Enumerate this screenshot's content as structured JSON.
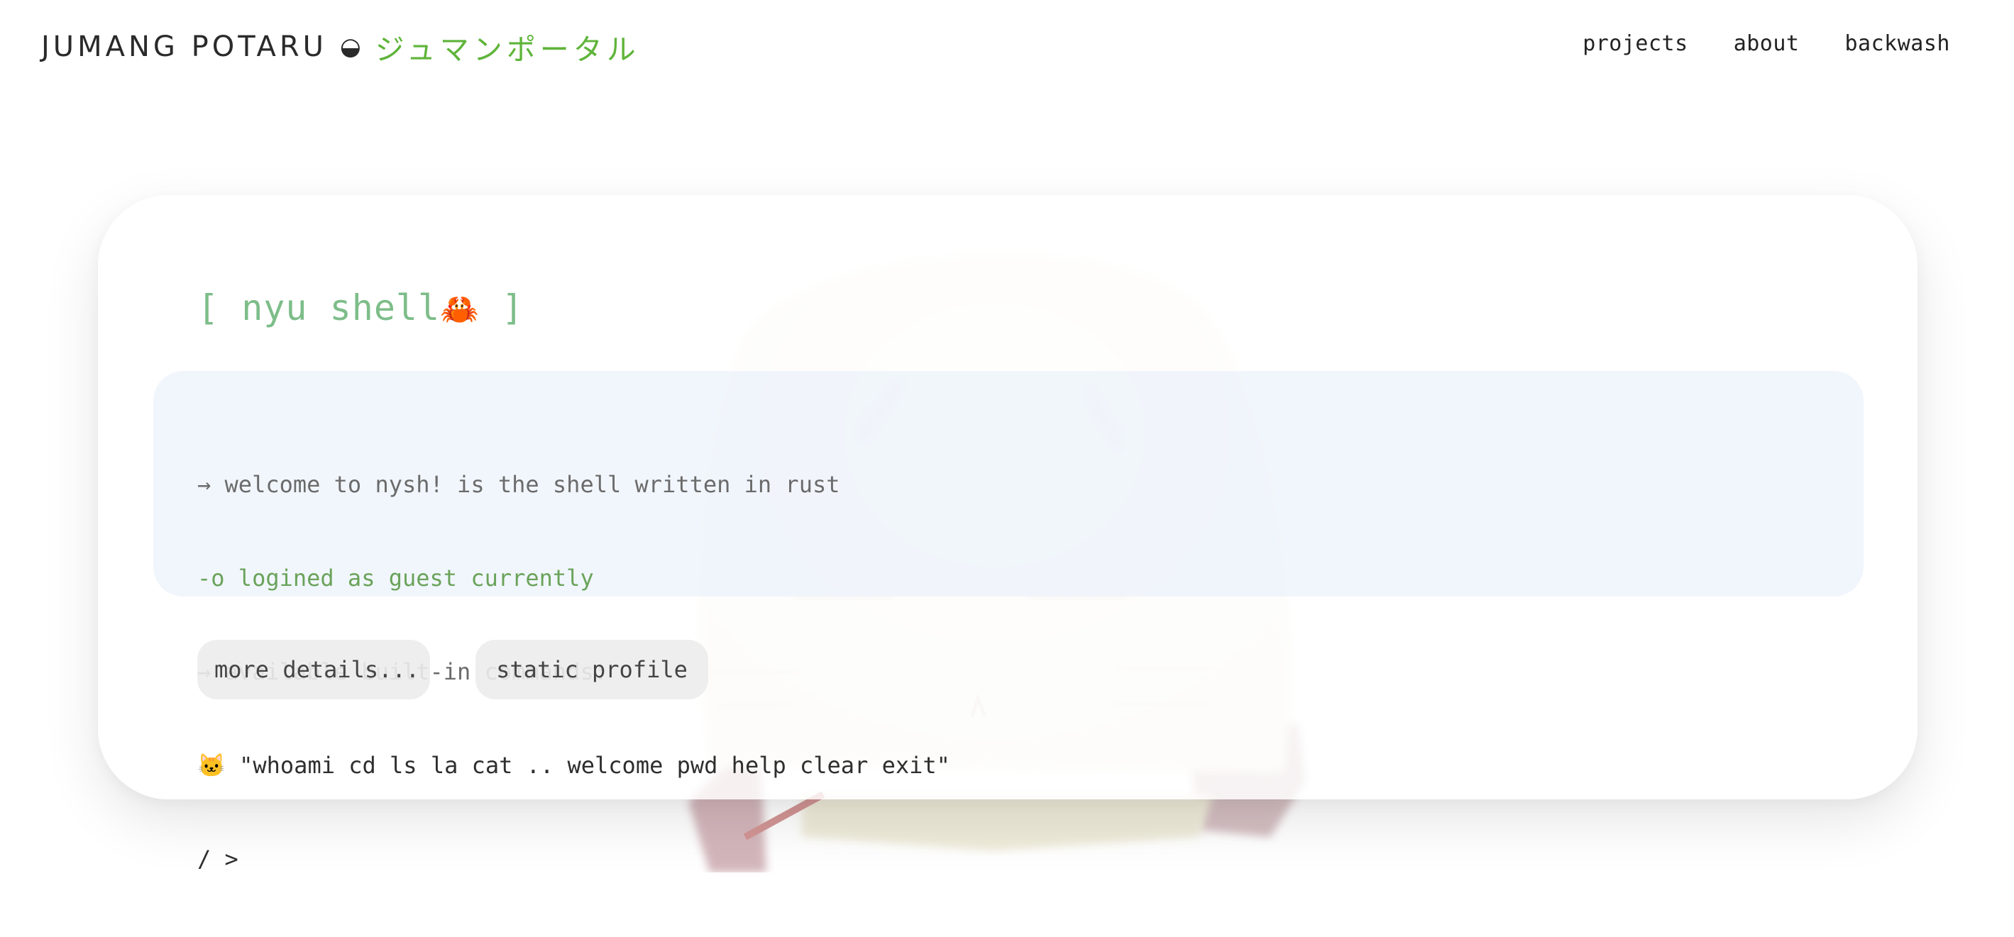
{
  "header": {
    "brand_latin": "JUMANG POTARU",
    "brand_symbol": "◒",
    "brand_jp": "ジュマンポータル",
    "nav": [
      {
        "label": "projects"
      },
      {
        "label": "about"
      },
      {
        "label": "backwash"
      }
    ]
  },
  "shell": {
    "title": "[ nyu shell",
    "title_emoji": "🦀",
    "title_close": " ]",
    "lines": [
      {
        "text": "→ welcome to nysh! is the shell written in rust"
      },
      {
        "text": "-o logined as guest currently"
      },
      {
        "text": "→ available built-in commands:"
      },
      {
        "icon": "🐱",
        "text": " \"whoami cd ls la cat .. welcome pwd help clear exit\""
      },
      {
        "text": "/ > "
      }
    ]
  },
  "buttons": {
    "more_details": "more details...",
    "static_profile": "static profile"
  },
  "colors": {
    "accent_green": "#5fb43a",
    "title_green": "#7dbd89",
    "line_green": "#6aa35a",
    "terminal_bg": "#eef3fa"
  }
}
